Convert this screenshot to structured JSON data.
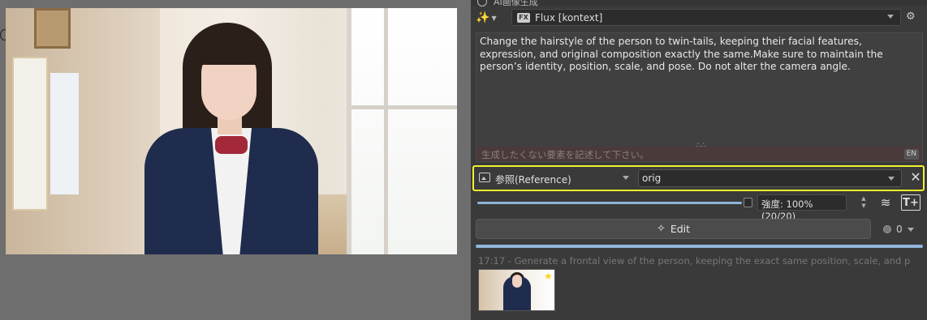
{
  "panel": {
    "title": "AI画像生成",
    "model": {
      "label": "Flux [kontext]",
      "icon": "FX"
    },
    "prompt": "Change the hairstyle of the person to twin-tails, keeping their facial features, expression, and original composition exactly the same.Make sure to maintain the person’s identity, position, scale, and pose. Do not alter the camera angle.",
    "negative_placeholder": "生成したくない要素を記述して下さい。",
    "lang_badge": "EN",
    "reference": {
      "mode_label": "参照(Reference)",
      "layer_label": "orig"
    },
    "strength": {
      "label": "強度: 100% (20/20)",
      "value_percent": 100
    },
    "edit_button": "Edit",
    "queue_count": "0",
    "history": {
      "label": "17:17 - Generate a frontal view of the person, keeping the exact same position, scale, and p"
    }
  },
  "icons": {
    "wand": "magic-wand-icon",
    "gears": "gears-icon",
    "reference": "image-icon",
    "close": "close-icon",
    "layers": "layers-add-icon",
    "text_add": "text-add-icon",
    "edit": "magic-wand-icon",
    "star": "star-icon"
  },
  "colors": {
    "highlight": "#f2f22a",
    "accent": "#8fb4d9",
    "star": "#ffd21e",
    "panel_bg": "#3a3a3a",
    "canvas_bg": "#6e6e6e"
  }
}
